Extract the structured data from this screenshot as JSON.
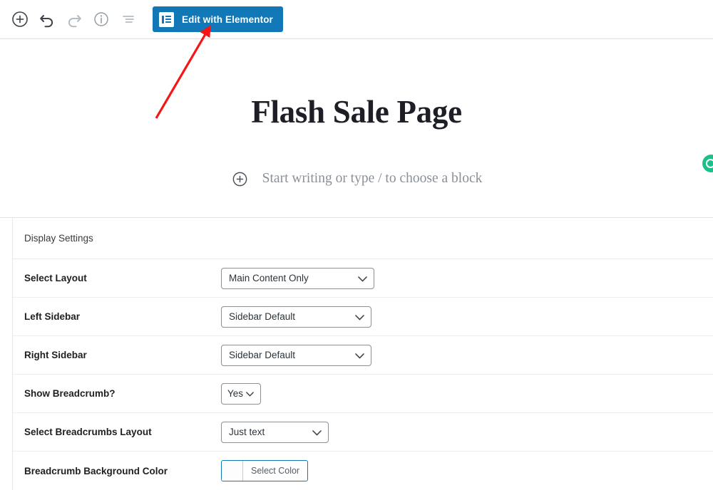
{
  "toolbar": {
    "icons": [
      {
        "name": "add-block-icon",
        "label": "Add block",
        "state": "enabled"
      },
      {
        "name": "undo-icon",
        "label": "Undo",
        "state": "enabled"
      },
      {
        "name": "redo-icon",
        "label": "Redo",
        "state": "disabled"
      },
      {
        "name": "info-icon",
        "label": "Details",
        "state": "enabled"
      },
      {
        "name": "list-view-icon",
        "label": "List view",
        "state": "enabled"
      }
    ],
    "elementor_button_label": "Edit with Elementor",
    "elementor_button_color": "#1177b7"
  },
  "editor": {
    "post_title": "Flash Sale Page",
    "paragraph_placeholder": "Start writing or type / to choose a block"
  },
  "support": {
    "bubble_color": "#19c08a"
  },
  "settings": {
    "header": "Display Settings",
    "rows": [
      {
        "label": "Select Layout",
        "control": "select",
        "value": "Main Content Only"
      },
      {
        "label": "Left Sidebar",
        "control": "select",
        "value": "Sidebar Default"
      },
      {
        "label": "Right Sidebar",
        "control": "select",
        "value": "Sidebar Default"
      },
      {
        "label": "Show Breadcrumb?",
        "control": "select",
        "value": "Yes"
      },
      {
        "label": "Select Breadcrumbs Layout",
        "control": "select",
        "value": "Just text"
      },
      {
        "label": "Breadcrumb Background Color",
        "control": "color-picker",
        "value": "Select Color"
      }
    ]
  },
  "annotation": {
    "arrow_color": "#f71414",
    "points_to": "Edit with Elementor"
  }
}
